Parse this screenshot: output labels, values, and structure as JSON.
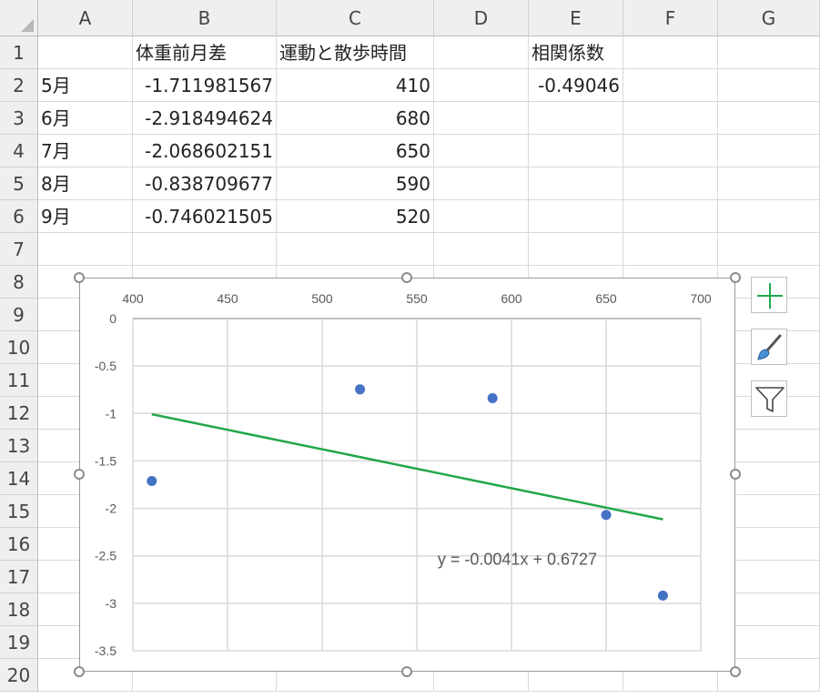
{
  "columns": [
    "A",
    "B",
    "C",
    "D",
    "E",
    "F",
    "G"
  ],
  "rows": [
    "1",
    "2",
    "3",
    "4",
    "5",
    "6",
    "7",
    "8",
    "9",
    "10",
    "11",
    "12",
    "13",
    "14",
    "15",
    "16",
    "17",
    "18",
    "19",
    "20"
  ],
  "cells": {
    "B1": "体重前月差",
    "C1": "運動と散歩時間",
    "E1": "相関係数",
    "A2": "5月",
    "B2": "-1.711981567",
    "C2": "410",
    "E2": "-0.49046",
    "A3": "6月",
    "B3": "-2.918494624",
    "C3": "680",
    "A4": "7月",
    "B4": "-2.068602151",
    "C4": "650",
    "A5": "8月",
    "B5": "-0.838709677",
    "C5": "590",
    "A6": "9月",
    "B6": "-0.746021505",
    "C6": "520"
  },
  "chart_data": {
    "type": "scatter",
    "x": [
      410,
      680,
      650,
      590,
      520
    ],
    "y": [
      -1.711981567,
      -2.918494624,
      -2.068602151,
      -0.838709677,
      -0.746021505
    ],
    "xlim": [
      400,
      700
    ],
    "ylim": [
      -3.5,
      0
    ],
    "x_ticks": [
      "400",
      "450",
      "500",
      "550",
      "600",
      "650",
      "700"
    ],
    "y_ticks": [
      "0",
      "-0.5",
      "-1",
      "-1.5",
      "-2",
      "-2.5",
      "-3",
      "-3.5"
    ],
    "x_axis_position": "top",
    "grid": true,
    "trendline": {
      "type": "linear",
      "equation": "y = -0.0041x + 0.6727",
      "slope": -0.0041,
      "intercept": 0.6727,
      "x_range": [
        410,
        680
      ]
    },
    "colors": {
      "points": "#4472c4",
      "trendline": "#21a74a",
      "grid": "#d9d9d9"
    }
  },
  "side_buttons": {
    "elements": "plus-icon",
    "styles": "brush-icon",
    "filter": "funnel-icon"
  }
}
